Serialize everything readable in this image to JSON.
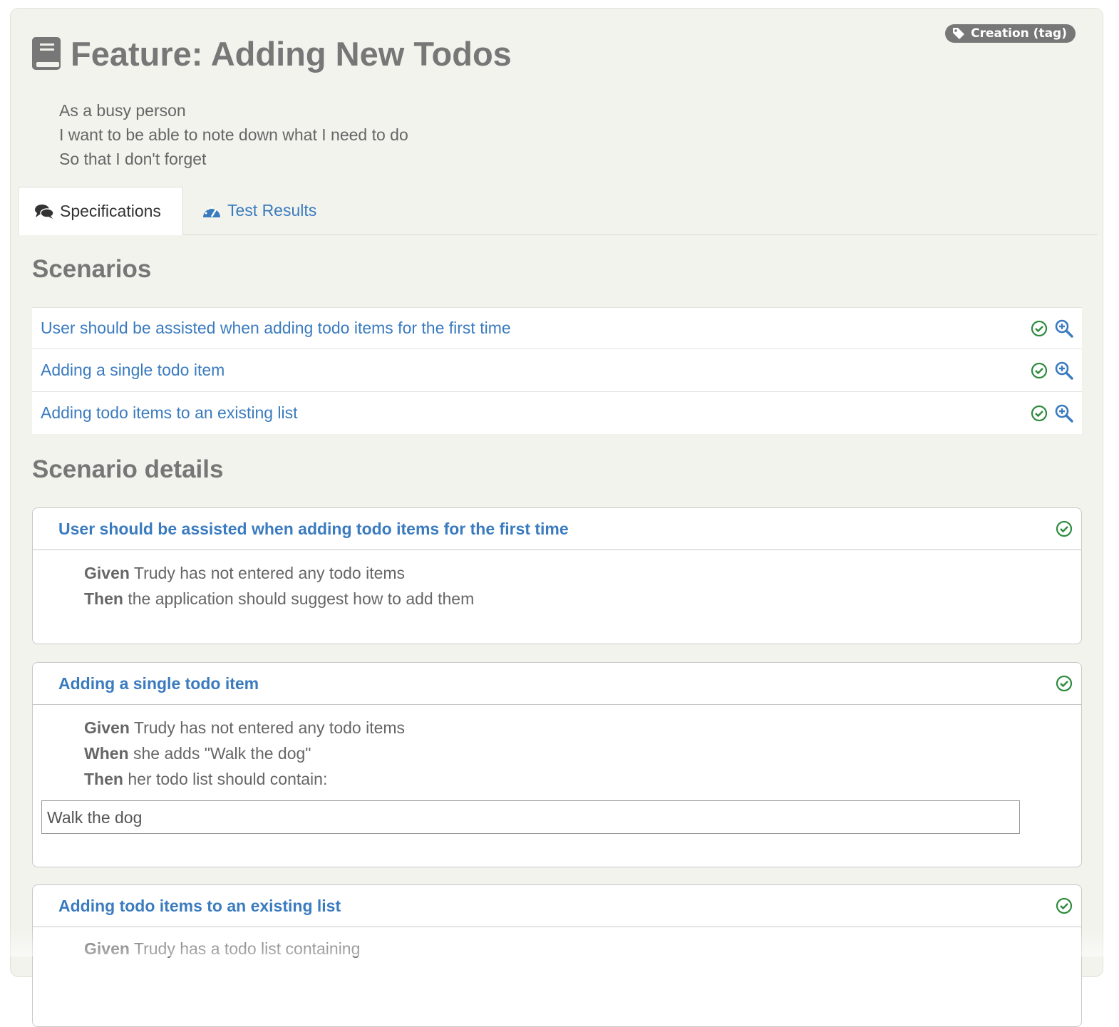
{
  "feature": {
    "title": "Feature: Adding New Todos",
    "tag": "Creation (tag)",
    "icon": "book-icon",
    "narrative": [
      "As a busy person",
      "I want to be able to note down what I need to do",
      "So that I don't forget"
    ]
  },
  "tabs": [
    {
      "label": "Specifications",
      "icon": "comments-icon",
      "active": true
    },
    {
      "label": "Test Results",
      "icon": "dashboard-icon",
      "active": false
    }
  ],
  "scenarios": {
    "heading": "Scenarios",
    "items": [
      {
        "title": "User should be assisted when adding todo items for the first time",
        "status": "passed"
      },
      {
        "title": "Adding a single todo item",
        "status": "passed"
      },
      {
        "title": "Adding todo items to an existing list",
        "status": "passed"
      }
    ]
  },
  "details": {
    "heading": "Scenario details",
    "cards": [
      {
        "title": "User should be assisted when adding todo items for the first time",
        "steps": [
          {
            "keyword": "Given",
            "text": " Trudy has not entered any todo items"
          },
          {
            "keyword": "Then",
            "text": " the application should suggest how to add them"
          }
        ]
      },
      {
        "title": "Adding a single todo item",
        "steps": [
          {
            "keyword": "Given",
            "text": " Trudy has not entered any todo items"
          },
          {
            "keyword": "When",
            "text": " she adds \"Walk the dog\""
          },
          {
            "keyword": "Then",
            "text": " her todo list should contain:"
          }
        ],
        "table": [
          "Walk the dog"
        ]
      },
      {
        "title": "Adding todo items to an existing list",
        "steps": [
          {
            "keyword": "Given",
            "text": " Trudy has a todo list containing"
          }
        ]
      }
    ]
  },
  "colors": {
    "link": "#3a7bbf",
    "success": "#2e8b3e",
    "heading": "#777777",
    "panel": "#f2f3ec"
  }
}
